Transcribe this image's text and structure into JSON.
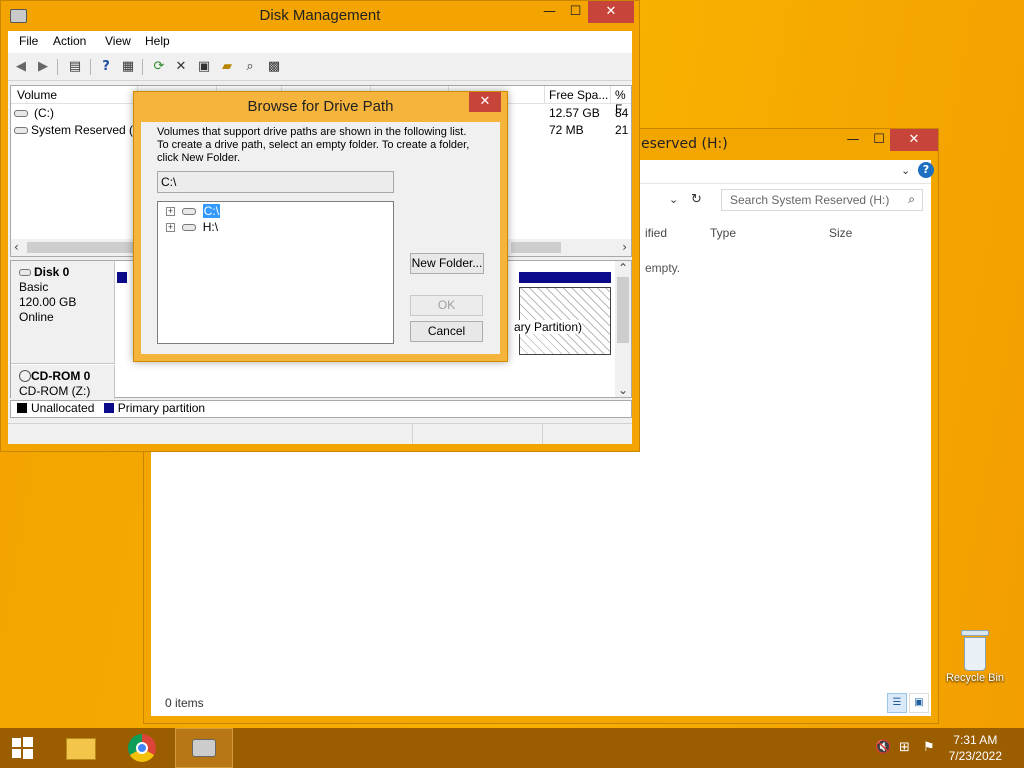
{
  "explorer": {
    "title": "eserved (H:)",
    "search_placeholder": "Search System Reserved (H:)",
    "columns": {
      "modified": "ified",
      "type": "Type",
      "size": "Size"
    },
    "empty_message": "empty.",
    "status": "0 items"
  },
  "diskmgmt": {
    "title": "Disk Management",
    "menu": [
      "File",
      "Action",
      "View",
      "Help"
    ],
    "volume_columns": {
      "volume": "Volume",
      "free_space": "Free Spa...",
      "pct_free": "% F"
    },
    "volumes": [
      {
        "name": "(C:)",
        "free": "12.57 GB",
        "pct": "84"
      },
      {
        "name": "System Reserved (",
        "free": "72 MB",
        "pct": "21"
      }
    ],
    "disks": [
      {
        "name": "Disk 0",
        "type": "Basic",
        "size": "120.00 GB",
        "status": "Online",
        "partition_label": "ary Partition)"
      },
      {
        "name": "CD-ROM 0",
        "type": "CD-ROM (Z:)"
      }
    ],
    "legend": {
      "unallocated": "Unallocated",
      "primary": "Primary partition"
    },
    "legend_colors": {
      "unallocated": "#000000",
      "primary": "#0a0a8a"
    }
  },
  "dialog": {
    "title": "Browse for Drive Path",
    "description_line1": "Volumes that support drive paths are shown in the following list.",
    "description_line2": "To create a drive path, select an empty folder. To create a folder,",
    "description_line3": "click New Folder.",
    "path_value": "C:\\",
    "tree": [
      {
        "label": "C:\\",
        "selected": true
      },
      {
        "label": "H:\\",
        "selected": false
      }
    ],
    "new_folder_label": "New Folder...",
    "ok_label": "OK",
    "cancel_label": "Cancel",
    "close_glyph": "✕"
  },
  "desktop": {
    "recycle_bin_label": "Recycle Bin"
  },
  "taskbar": {
    "time": "7:31 AM",
    "date": "7/23/2022",
    "items": [
      "start-icon",
      "file-explorer-icon",
      "chrome-icon",
      "disk-management-icon"
    ]
  },
  "colors": {
    "desktop": "#f5a800",
    "window_frame": "#f3a400",
    "close_red": "#c7443a",
    "selection": "#3399ff"
  }
}
